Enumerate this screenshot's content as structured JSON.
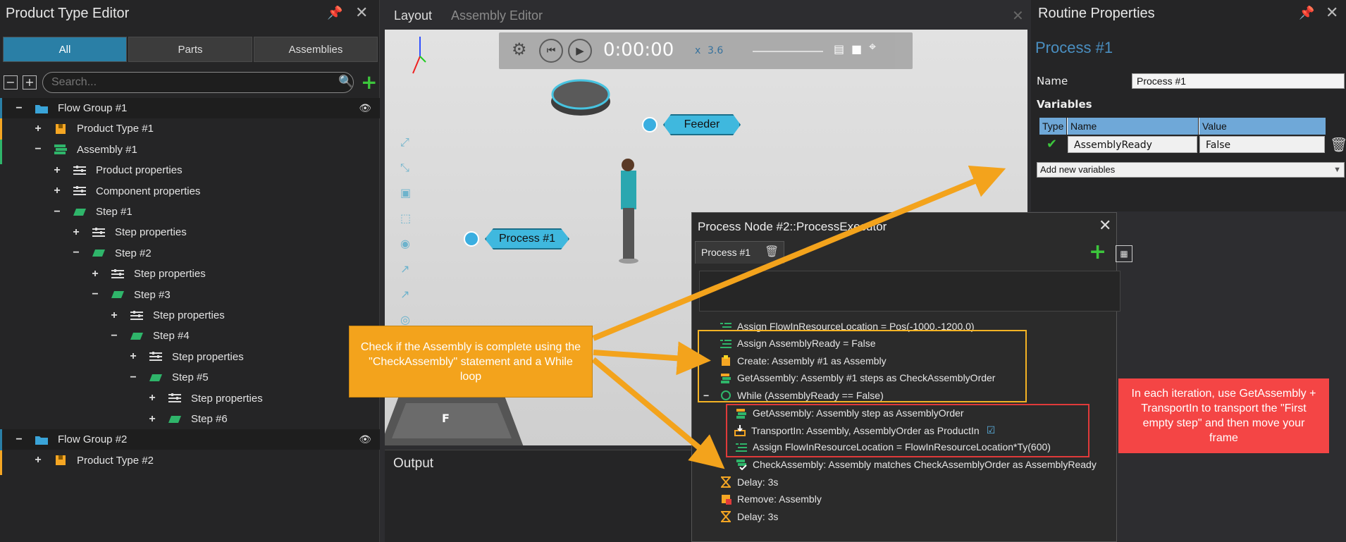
{
  "left_panel": {
    "title": "Product Type Editor",
    "tabs": [
      "All",
      "Parts",
      "Assemblies"
    ],
    "search_placeholder": "Search...",
    "tree": [
      {
        "label": "Flow Group #1",
        "type": "group",
        "sign": "−",
        "depth": 0
      },
      {
        "label": "Product Type #1",
        "type": "product",
        "sign": "+",
        "depth": 1
      },
      {
        "label": "Assembly #1",
        "type": "assembly",
        "sign": "−",
        "depth": 1
      },
      {
        "label": "Product properties",
        "type": "props",
        "sign": "+",
        "depth": 2
      },
      {
        "label": "Component properties",
        "type": "props",
        "sign": "+",
        "depth": 2
      },
      {
        "label": "Step #1",
        "type": "step",
        "sign": "−",
        "depth": 2
      },
      {
        "label": "Step properties",
        "type": "props",
        "sign": "+",
        "depth": 3
      },
      {
        "label": "Step #2",
        "type": "step",
        "sign": "−",
        "depth": 3
      },
      {
        "label": "Step properties",
        "type": "props",
        "sign": "+",
        "depth": 4
      },
      {
        "label": "Step #3",
        "type": "step",
        "sign": "−",
        "depth": 4
      },
      {
        "label": "Step properties",
        "type": "props",
        "sign": "+",
        "depth": 5
      },
      {
        "label": "Step #4",
        "type": "step",
        "sign": "−",
        "depth": 5
      },
      {
        "label": "Step properties",
        "type": "props",
        "sign": "+",
        "depth": 6
      },
      {
        "label": "Step #5",
        "type": "step",
        "sign": "−",
        "depth": 6
      },
      {
        "label": "Step properties",
        "type": "props",
        "sign": "+",
        "depth": 7
      },
      {
        "label": "Step #6",
        "type": "step",
        "sign": "+",
        "depth": 7
      },
      {
        "label": "Flow Group #2",
        "type": "group",
        "sign": "−",
        "depth": 0
      },
      {
        "label": "Product Type #2",
        "type": "product",
        "sign": "+",
        "depth": 1
      }
    ]
  },
  "center": {
    "tabs": [
      "Layout",
      "Assembly Editor"
    ],
    "time": "0:00:00",
    "speed_prefix": "x",
    "speed": "3.6",
    "labels": {
      "feeder": "Feeder",
      "process": "Process #1",
      "floor": "F"
    },
    "output_title": "Output"
  },
  "right_panel": {
    "title": "Routine Properties",
    "subtitle": "Process #1",
    "name_label": "Name",
    "name_value": "Process #1",
    "variables_label": "Variables",
    "columns": [
      "Type",
      "Name",
      "Value"
    ],
    "variable": {
      "name": "AssemblyReady",
      "value": "False"
    },
    "add_variables": "Add new variables"
  },
  "process_node": {
    "title": "Process Node #2::ProcessExecutor",
    "tab": "Process #1",
    "lines": [
      {
        "text": "Assign FlowInResourceLocation = Pos(-1000,-1200,0)",
        "icon": "assign"
      },
      {
        "text": "Assign AssemblyReady = False",
        "icon": "assign"
      },
      {
        "text": "Create: Assembly #1 as Assembly",
        "icon": "create"
      },
      {
        "text": "GetAssembly: Assembly #1 steps as CheckAssemblyOrder",
        "icon": "get"
      },
      {
        "text": "While (AssemblyReady == False)",
        "icon": "while"
      },
      {
        "text": "GetAssembly: Assembly step as AssemblyOrder",
        "icon": "get"
      },
      {
        "text": "TransportIn: Assembly, AssemblyOrder as ProductIn",
        "icon": "transport"
      },
      {
        "text": "Assign FlowInResourceLocation = FlowInResourceLocation*Ty(600)",
        "icon": "assign"
      },
      {
        "text": "CheckAssembly: Assembly matches CheckAssemblyOrder as AssemblyReady",
        "icon": "check"
      },
      {
        "text": "Delay: 3s",
        "icon": "delay"
      },
      {
        "text": "Remove: Assembly",
        "icon": "remove"
      },
      {
        "text": "Delay: 3s",
        "icon": "delay"
      }
    ]
  },
  "callouts": {
    "left": "Check if the Assembly is complete using the \"CheckAssembly\" statement and a While loop",
    "right": "In each iteration, use GetAssembly + TransportIn to transport the \"First empty step\" and then move your frame"
  },
  "colors": {
    "accent": "#2a7fa6",
    "callout_orange": "#f3a31c",
    "callout_red": "#f44545",
    "highlight_yellow": "#f5b324",
    "highlight_red": "#e03a3a"
  }
}
